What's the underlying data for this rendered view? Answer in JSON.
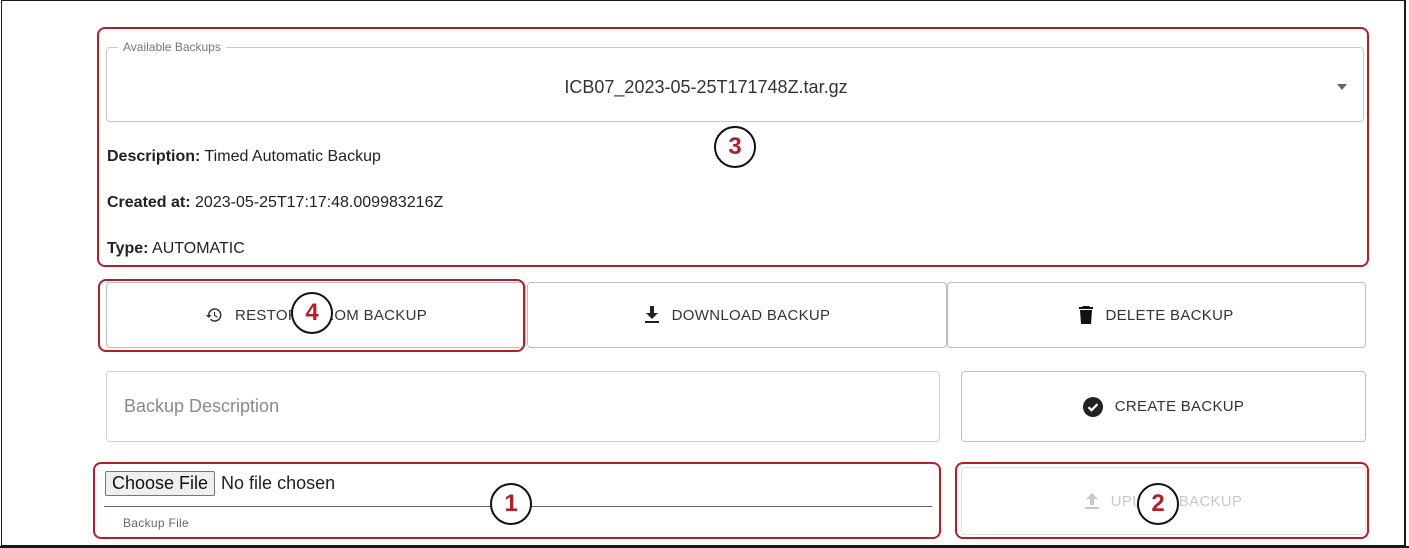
{
  "available_backups": {
    "legend": "Available Backups",
    "selected": "ICB07_2023-05-25T171748Z.tar.gz"
  },
  "details": {
    "description_label": "Description:",
    "description_value": "Timed Automatic Backup",
    "created_label": "Created at:",
    "created_value": "2023-05-25T17:17:48.009983216Z",
    "type_label": "Type:",
    "type_value": "AUTOMATIC"
  },
  "actions": {
    "restore_label": "RESTORE FROM BACKUP",
    "download_label": "DOWNLOAD BACKUP",
    "delete_label": "DELETE BACKUP",
    "create_label": "CREATE BACKUP",
    "upload_label": "UPLOAD BACKUP"
  },
  "backup_description": {
    "placeholder": "Backup Description"
  },
  "backup_file": {
    "button_label": "Choose File",
    "status": "No file chosen",
    "label": "Backup File"
  },
  "callouts": {
    "c1": "1",
    "c2": "2",
    "c3": "3",
    "c4": "4"
  },
  "colors": {
    "callout": "#b0202a",
    "disabled": "#c8c8c8"
  }
}
